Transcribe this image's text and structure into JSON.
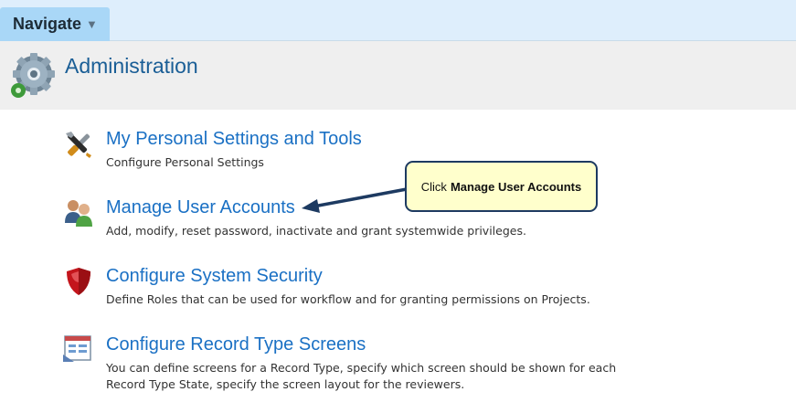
{
  "nav": {
    "label": "Navigate",
    "caret": "▼"
  },
  "header": {
    "title": "Administration",
    "icon": "gear-icon"
  },
  "items": [
    {
      "title": "My Personal Settings and Tools",
      "desc": "Configure Personal Settings",
      "icon": "tools-icon"
    },
    {
      "title": "Manage User Accounts",
      "desc": "Add, modify, reset password, inactivate and grant systemwide privileges.",
      "icon": "users-icon"
    },
    {
      "title": "Configure System Security",
      "desc": "Define Roles that can be used for workflow and for granting permissions on Projects.",
      "icon": "shield-icon"
    },
    {
      "title": "Configure Record Type Screens",
      "desc": "You can define screens for a Record Type, specify which screen should be shown for each Record Type State, specify the screen layout for the reviewers.",
      "icon": "form-layout-icon"
    }
  ],
  "callout": {
    "prefix": "Click",
    "emphasis": "Manage User Accounts"
  },
  "colors": {
    "link": "#1a70c4",
    "title": "#1a5e96",
    "callout_bg": "#ffffcc",
    "arrow": "#1d3a61"
  }
}
